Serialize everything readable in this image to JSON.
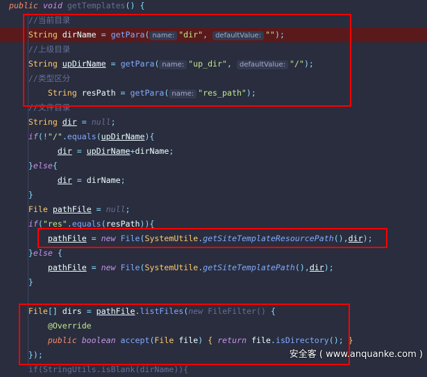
{
  "editor": {
    "highlight_line": 2,
    "lines": [
      [
        [
          "public ",
          "pub"
        ],
        [
          "void ",
          "kw"
        ],
        [
          "getTemplates",
          "dim"
        ],
        [
          "() {",
          "op"
        ]
      ],
      [
        [
          "    //当前目录",
          "cm"
        ]
      ],
      [
        [
          "    String ",
          "ty"
        ],
        [
          "dirName ",
          "id"
        ],
        [
          "= ",
          "op"
        ],
        [
          "getPara",
          "fn"
        ],
        [
          "(",
          "op"
        ],
        [
          "name:",
          "hint"
        ],
        [
          "\"dir\"",
          "str"
        ],
        [
          ", ",
          "op"
        ],
        [
          "defaultValue:",
          "hint"
        ],
        [
          "\"\"",
          "str"
        ],
        [
          ");",
          "op"
        ]
      ],
      [
        [
          "    //上级目录",
          "cm"
        ]
      ],
      [
        [
          "    String ",
          "ty"
        ],
        [
          "upDirName",
          "ul"
        ],
        [
          " = ",
          "op"
        ],
        [
          "getPara",
          "fn"
        ],
        [
          "(",
          "op"
        ],
        [
          "name:",
          "hint"
        ],
        [
          "\"up_dir\"",
          "str"
        ],
        [
          ", ",
          "op"
        ],
        [
          "defaultValue:",
          "hint"
        ],
        [
          "\"/\"",
          "str"
        ],
        [
          ");",
          "op"
        ]
      ],
      [
        [
          "    //类型区分",
          "cm"
        ]
      ],
      [
        [
          "        String ",
          "ty"
        ],
        [
          "resPath ",
          "id"
        ],
        [
          "= ",
          "op"
        ],
        [
          "getPara",
          "fn"
        ],
        [
          "(",
          "op"
        ],
        [
          "name:",
          "hint"
        ],
        [
          "\"res_path\"",
          "str"
        ],
        [
          ");",
          "op"
        ]
      ],
      [
        [
          "    //文件目录",
          "cm"
        ]
      ],
      [
        [
          "    String ",
          "ty"
        ],
        [
          "dir",
          "ul"
        ],
        [
          " = ",
          "op"
        ],
        [
          "null",
          "nul"
        ],
        [
          ";",
          "op"
        ]
      ],
      [
        [
          "    if",
          "kw"
        ],
        [
          "(!",
          "op"
        ],
        [
          "\"/\"",
          "str"
        ],
        [
          ".",
          "op"
        ],
        [
          "equals",
          "fn"
        ],
        [
          "(",
          "op"
        ],
        [
          "upDirName",
          "ul"
        ],
        [
          "){",
          "op"
        ]
      ],
      [
        [
          "          ",
          "id"
        ],
        [
          "dir",
          "ul"
        ],
        [
          " = ",
          "op"
        ],
        [
          "upDirName",
          "ul"
        ],
        [
          "+",
          "op"
        ],
        [
          "dirName",
          "id"
        ],
        [
          ";",
          "op"
        ]
      ],
      [
        [
          "    }",
          "op"
        ],
        [
          "else",
          "kw"
        ],
        [
          "{",
          "op"
        ]
      ],
      [
        [
          "          ",
          "id"
        ],
        [
          "dir",
          "ul"
        ],
        [
          " = ",
          "op"
        ],
        [
          "dirName",
          "id"
        ],
        [
          ";",
          "op"
        ]
      ],
      [
        [
          "    }",
          "op"
        ]
      ],
      [
        [
          "    File ",
          "ty"
        ],
        [
          "pathFile",
          "ul"
        ],
        [
          " = ",
          "op"
        ],
        [
          "null",
          "nul"
        ],
        [
          ";",
          "op"
        ]
      ],
      [
        [
          "    if",
          "kw"
        ],
        [
          "(",
          "op"
        ],
        [
          "\"res\"",
          "str"
        ],
        [
          ".",
          "op"
        ],
        [
          "equals",
          "fn"
        ],
        [
          "(",
          "op"
        ],
        [
          "resPath",
          "id"
        ],
        [
          ")){",
          "op"
        ]
      ],
      [
        [
          "        ",
          "id"
        ],
        [
          "pathFile",
          "ul"
        ],
        [
          " = ",
          "op"
        ],
        [
          "new ",
          "kw"
        ],
        [
          "File",
          "fn"
        ],
        [
          "(",
          "op"
        ],
        [
          "SystemUtile",
          "ty"
        ],
        [
          ".",
          "op"
        ],
        [
          "getSiteTemplateResourcePath",
          "fni"
        ],
        [
          "(),",
          "op"
        ],
        [
          "dir",
          "ul"
        ],
        [
          ");",
          "op"
        ]
      ],
      [
        [
          "    }",
          "op"
        ],
        [
          "else ",
          "kw"
        ],
        [
          "{",
          "op"
        ]
      ],
      [
        [
          "        ",
          "id"
        ],
        [
          "pathFile",
          "ul"
        ],
        [
          " = ",
          "op"
        ],
        [
          "new ",
          "kw"
        ],
        [
          "File",
          "fn"
        ],
        [
          "(",
          "op"
        ],
        [
          "SystemUtile",
          "ty"
        ],
        [
          ".",
          "op"
        ],
        [
          "getSiteTemplatePath",
          "fni"
        ],
        [
          "(),",
          "op"
        ],
        [
          "dir",
          "ul"
        ],
        [
          ");",
          "op"
        ]
      ],
      [
        [
          "    }",
          "op"
        ]
      ],
      [
        [
          "",
          "id"
        ]
      ],
      [
        [
          "    File",
          "ty"
        ],
        [
          "[] ",
          "op"
        ],
        [
          "dirs ",
          "id"
        ],
        [
          "= ",
          "op"
        ],
        [
          "pathFile",
          "ul"
        ],
        [
          ".",
          "op"
        ],
        [
          "listFiles",
          "fn"
        ],
        [
          "(",
          "op"
        ],
        [
          "new ",
          "nul"
        ],
        [
          "FileFilter() ",
          "dim"
        ],
        [
          "{",
          "op"
        ]
      ],
      [
        [
          "        @Override",
          "ann"
        ]
      ],
      [
        [
          "        public ",
          "pub"
        ],
        [
          "boolean ",
          "kw"
        ],
        [
          "accept",
          "fn"
        ],
        [
          "(",
          "op"
        ],
        [
          "File ",
          "ty"
        ],
        [
          "file",
          "id"
        ],
        [
          ") ",
          "op"
        ],
        [
          "{ ",
          "ty"
        ],
        [
          "return ",
          "kw"
        ],
        [
          "file",
          "id"
        ],
        [
          ".",
          "op"
        ],
        [
          "isDirectory",
          "fn"
        ],
        [
          "(); ",
          "op"
        ],
        [
          "}",
          "ty"
        ]
      ],
      [
        [
          "    });",
          "op"
        ]
      ],
      [
        [
          "    if(StringUtils.isBlank(dirName)){",
          "dim"
        ]
      ]
    ]
  },
  "watermark": "安全客 ( www.anquanke.com )"
}
